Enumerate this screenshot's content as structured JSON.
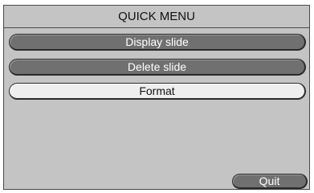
{
  "menu": {
    "title": "QUICK MENU",
    "items": [
      {
        "label": "Display slide",
        "state": "normal"
      },
      {
        "label": "Delete slide",
        "state": "normal"
      },
      {
        "label": "Format",
        "state": "selected"
      }
    ],
    "quit_label": "Quit"
  },
  "colors": {
    "panel_background": "#c4c4c4",
    "button_background": "#707070",
    "button_text": "#ffffff",
    "selected_background": "#eeeeee",
    "selected_text": "#111111",
    "border": "#2a2a2a"
  }
}
